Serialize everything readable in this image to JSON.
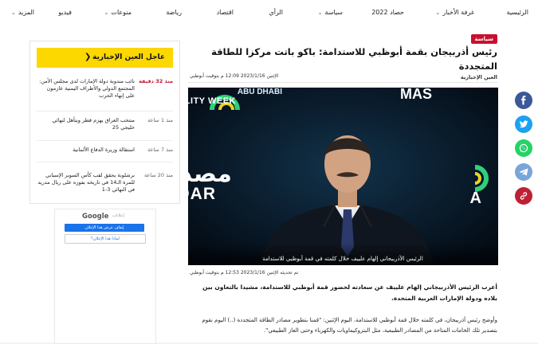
{
  "nav": {
    "items": [
      {
        "label": "الرئيسية",
        "chevron": false
      },
      {
        "label": "غرفة الأخبار",
        "chevron": true
      },
      {
        "label": "حصاد 2022",
        "chevron": false
      },
      {
        "label": "سياسة",
        "chevron": true
      },
      {
        "label": "الرأي",
        "chevron": false
      },
      {
        "label": "اقتصاد",
        "chevron": false
      },
      {
        "label": "رياضة",
        "chevron": false
      },
      {
        "label": "منوعات",
        "chevron": true
      },
      {
        "label": "فيديو",
        "chevron": false
      },
      {
        "label": "المزيد",
        "chevron": true
      }
    ]
  },
  "article": {
    "section": "سياسة",
    "title": "رئيس أذربيجان بقمة أبوظبي للاستدامة: باكو باتت مركزا للطاقة المتجددة",
    "source": "العين الإخبارية",
    "published": "الإثنين 2023/1/16 12:09 م بتوقيت أبوظبي",
    "photo_caption": "الرئيس الأذربيجاني إلهام علييف خلال كلمته في قمة أبوظبي للاستدامة",
    "photo_banner_top": "SUSTAINABILITY WEEK",
    "photo_arabic": "مصدر",
    "photo_masdar": "MASDAR",
    "photo_top_left": "ABU DHABI",
    "photo_top_right": "MAS",
    "updated": "تم تحديثه الإثنين 2023/1/16 12:53 م بتوقيت أبوظبي",
    "lead": "أعرب الرئيس الأذربيجاني إلهام علييف عن سعادته لحضور قمة أبوظبي للاستدامة، مشيدا بالتعاون بين بلاده ودولة الإمارات العربية المتحدة.",
    "body": "وأوضح رئيس أذربيجان، في كلمته خلال قمة أبوظبي للاستدامة، اليوم الإثنين: \"قمنا بتطوير مصادر الطاقة المتجددة (..) اليوم نقوم بتصدير تلك الخامات المتاحة من المصادر الطبيعية، مثل البتروكيماويات والكهرباء وحتى الغاز الطبيعي\"."
  },
  "sidebar": {
    "title": "عاجل العين الإخبارية",
    "items": [
      {
        "time": "منذ 32 دقيقة",
        "text": "نائب مندوبة دولة الإمارات لدى مجلس الأمن: المجتمع الدولي والأطراف اليمنية عازمون على إنهاء الحرب",
        "highlight": true
      },
      {
        "time": "منذ 1 ساعة",
        "text": "منتخب العراق يهزم قطر ويتأهل لنهائي خليجي 25",
        "highlight": false
      },
      {
        "time": "منذ 7 ساعة",
        "text": "استقالة وزيرة الدفاع الألمانية",
        "highlight": false
      },
      {
        "time": "منذ 20 ساعة",
        "text": "برشلونة يحقق لقب كأس السوبر الإسباني للمرة الـ14 في تاريخه بفوزه على ريال مدريد في النهائي 3-1",
        "highlight": false
      }
    ]
  },
  "ad": {
    "label": "إعلانات",
    "brand": "Google",
    "button_primary": "إيقاف عرض هذا الإعلان",
    "button_secondary": "لماذا هذا الإعلان؟"
  },
  "colors": {
    "accent_red": "#c8102e",
    "sidebar_yellow": "#fcd700",
    "facebook": "#3b5998",
    "twitter": "#1da1f2",
    "whatsapp": "#25d366",
    "telegram": "#7aa5d8",
    "pinterest": "#bd2135"
  },
  "share_icons": [
    "facebook-icon",
    "twitter-icon",
    "whatsapp-icon",
    "telegram-icon",
    "link-icon"
  ]
}
